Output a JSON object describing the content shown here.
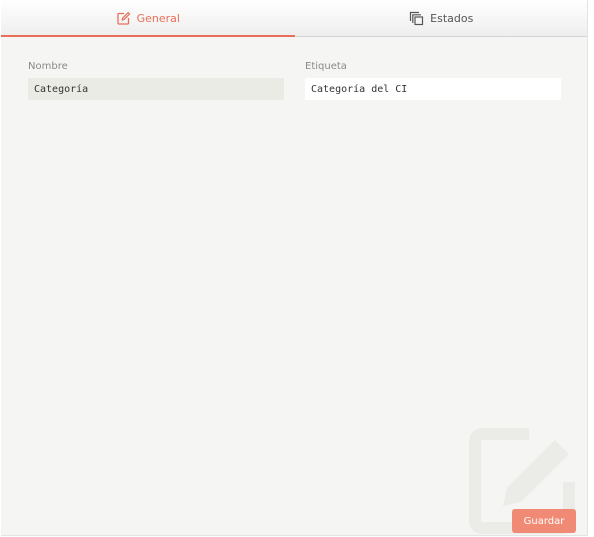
{
  "tabs": [
    {
      "label": "General",
      "icon": "edit-icon",
      "active": true
    },
    {
      "label": "Estados",
      "icon": "copy-icon",
      "active": false
    }
  ],
  "form": {
    "nombre": {
      "label": "Nombre",
      "value": "Categoría"
    },
    "etiqueta": {
      "label": "Etiqueta",
      "value": "Categoría del CI"
    }
  },
  "footer": {
    "save_label": "Guardar"
  },
  "colors": {
    "accent": "#e8705a",
    "button": "#f08a74",
    "background": "#f5f5f3"
  }
}
